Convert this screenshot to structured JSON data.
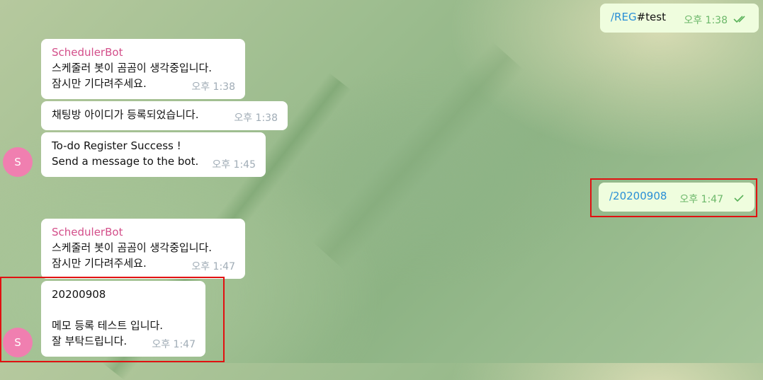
{
  "outgoing": [
    {
      "command": "/REG",
      "text": "#test",
      "time": "오후 1:38",
      "status": "read"
    },
    {
      "command": "/20200908",
      "text": "",
      "time": "오후 1:47",
      "status": "sent"
    }
  ],
  "incoming": [
    {
      "sender": "SchedulerBot",
      "lines": [
        "스케줄러 봇이 곰곰이 생각중입니다.",
        "잠시만 기다려주세요."
      ],
      "time": "오후 1:38"
    },
    {
      "lines": [
        "채팅방 아이디가 등록되었습니다."
      ],
      "time": "오후 1:38"
    },
    {
      "lines": [
        "To-do Register Success !",
        "Send a message to the bot."
      ],
      "time": "오후 1:45"
    },
    {
      "sender": "SchedulerBot",
      "lines": [
        "스케줄러 봇이 곰곰이 생각중입니다.",
        "잠시만 기다려주세요."
      ],
      "time": "오후 1:47"
    },
    {
      "lines": [
        "20200908",
        "",
        "메모 등록 테스트 입니다.",
        "잘 부탁드립니다."
      ],
      "time": "오후 1:47"
    }
  ],
  "avatar": {
    "initial": "S",
    "color": "#f07fb0"
  },
  "icons": {
    "read": "double-check-icon",
    "sent": "single-check-icon"
  },
  "colors": {
    "incoming_bg": "#ffffff",
    "outgoing_bg": "#effdde",
    "sender_name": "#d34e8a",
    "highlight": "#e11111"
  }
}
